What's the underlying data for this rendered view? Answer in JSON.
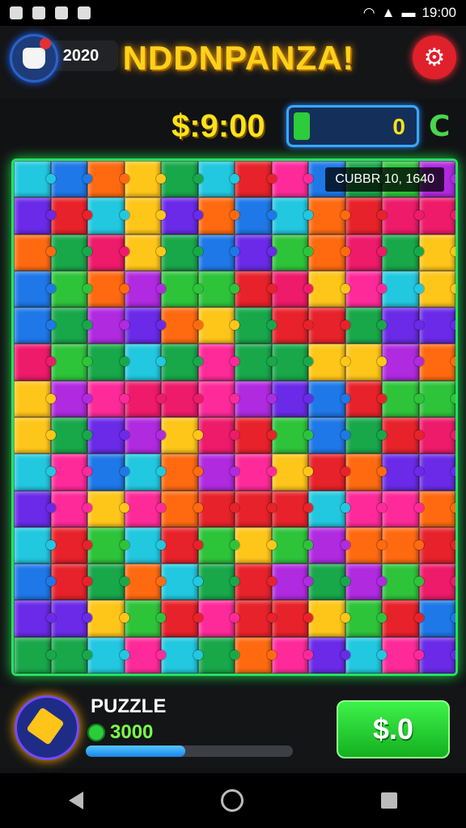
{
  "status_bar": {
    "time": "19:00"
  },
  "header": {
    "score": "2020",
    "title": "NDDNPANZA!"
  },
  "money": {
    "amount": "$:9:00",
    "gems": "0"
  },
  "board": {
    "label": "CUBBR 10, 1640"
  },
  "bottom": {
    "puzzle_label": "PUZZLE",
    "coins": "3000",
    "progress_fraction": 0.48,
    "cash_button": "$.0"
  },
  "colors": {
    "accent_green": "#27e060",
    "title_yellow": "#ffd11a",
    "button_red": "#e0202a",
    "button_green": "#14b020",
    "progress_blue": "#1a86e8"
  },
  "puzzle_palette": [
    "#e8222a",
    "#ff6a10",
    "#ffc61a",
    "#2ec43a",
    "#18a84a",
    "#22c8e0",
    "#1e78e8",
    "#6a2ae8",
    "#b02ae0",
    "#ff2a9a",
    "#ee1a6a"
  ]
}
